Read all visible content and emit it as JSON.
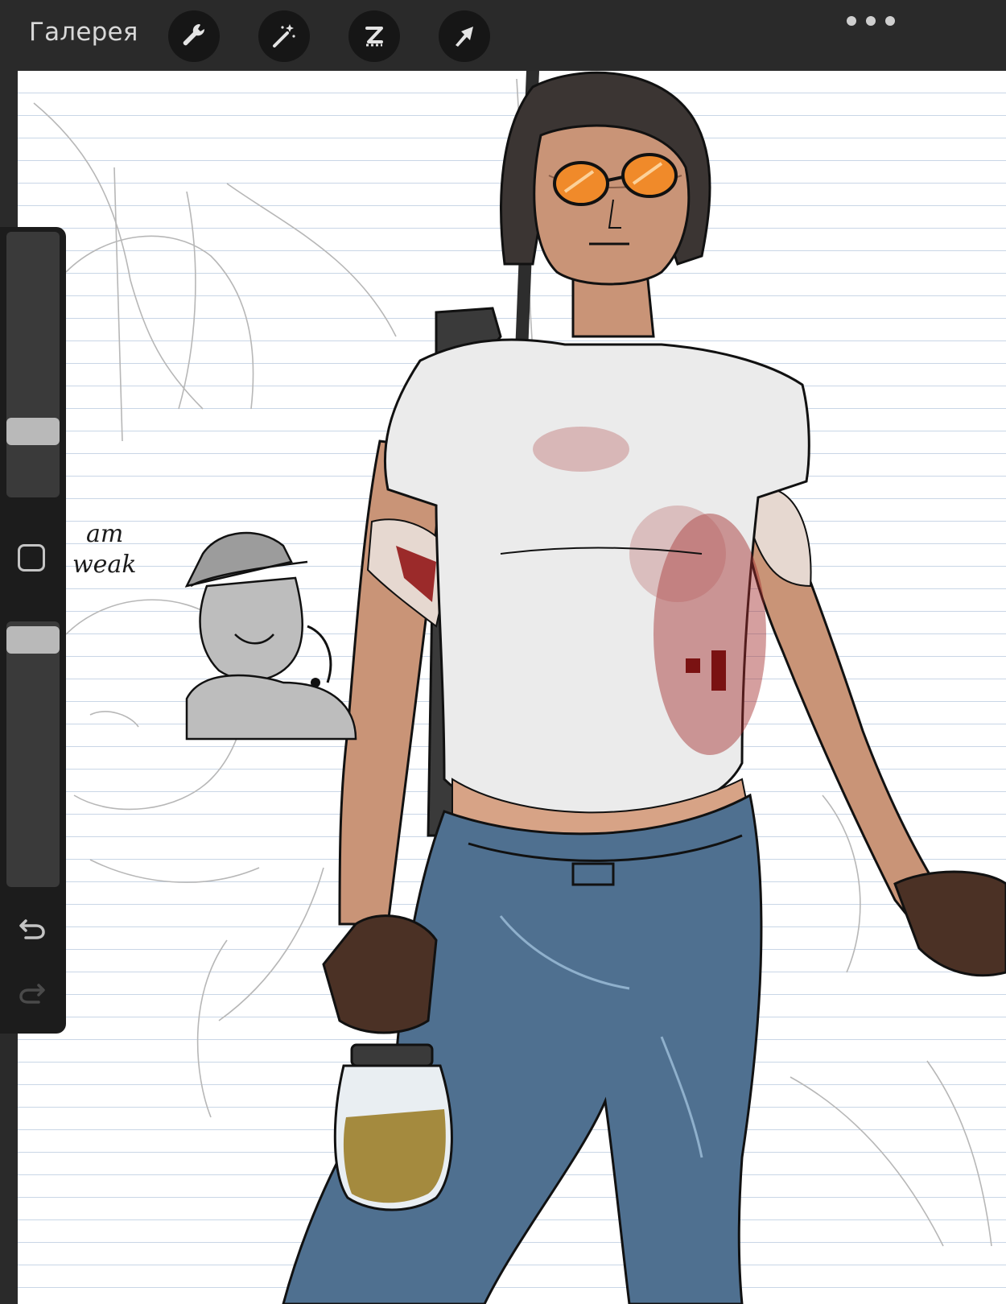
{
  "toolbar": {
    "gallery_label": "Галерея",
    "tools": [
      {
        "name": "actions",
        "icon": "wrench-icon"
      },
      {
        "name": "adjustments",
        "icon": "magic-wand-icon"
      },
      {
        "name": "selection",
        "icon": "selection-s-icon"
      },
      {
        "name": "transform",
        "icon": "arrow-cursor-icon"
      }
    ],
    "more_icon": "more-dots-icon"
  },
  "canvas": {
    "doodle_text": {
      "line1": "am",
      "line2": "weak"
    }
  },
  "sidebar": {
    "brush_size": 0.22,
    "brush_opacity": 0.98,
    "modify_icon": "square-modify-icon",
    "undo_icon": "undo-icon",
    "redo_icon": "redo-icon"
  },
  "colors": {
    "toolbar_bg": "#2a2a2a",
    "sidebar_bg": "#1c1c1c",
    "paper_line": "#c9d6e6",
    "shirt": "#ebebeb",
    "jeans": "#4f7090",
    "skin": "#c99477",
    "blood": "#9b2a2a",
    "lens": "#f08a2a"
  }
}
